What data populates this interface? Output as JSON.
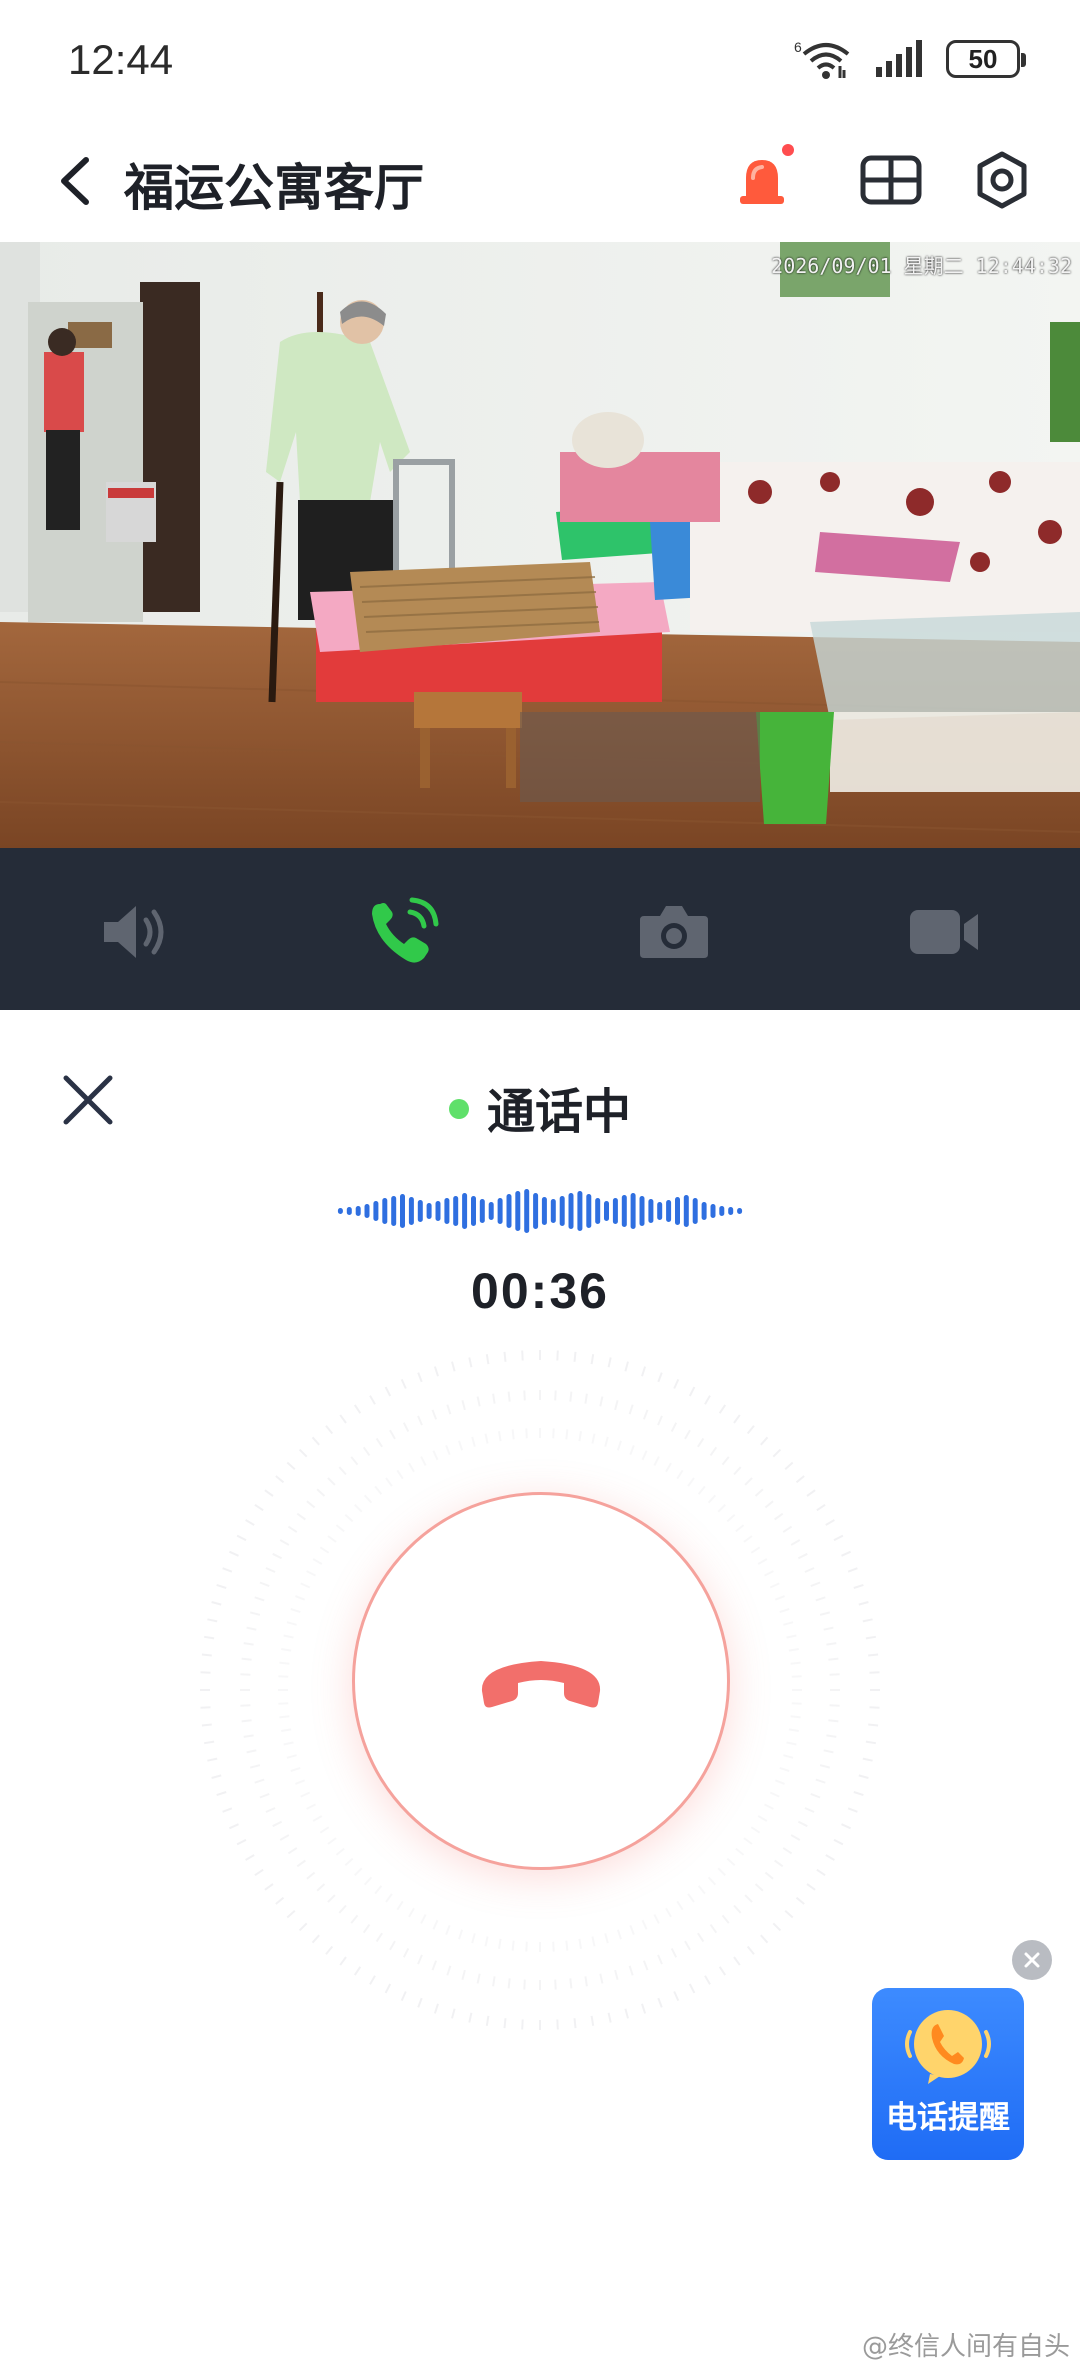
{
  "status_bar": {
    "time": "12:44",
    "network": "6",
    "battery": "50"
  },
  "header": {
    "title": "福运公寓客厅",
    "icons": [
      "back-arrow-icon",
      "alarm-bell-icon",
      "grid-layout-icon",
      "settings-icon"
    ]
  },
  "video": {
    "timestamp": "2026/09/01 星期二 12:44:32"
  },
  "controls": [
    {
      "name": "speaker",
      "icon": "speaker-icon",
      "active": false
    },
    {
      "name": "call",
      "icon": "phone-call-icon",
      "active": true
    },
    {
      "name": "snapshot",
      "icon": "camera-icon",
      "active": false
    },
    {
      "name": "record",
      "icon": "video-record-icon",
      "active": false
    }
  ],
  "call": {
    "status": "通话中",
    "duration": "00:36"
  },
  "ad": {
    "label": "电话提醒"
  },
  "watermark": "@终信人间有自头",
  "colors": {
    "control_bar": "#252c38",
    "call_active": "#31c94a",
    "hangup": "#f26f6b",
    "alarm": "#ff5a3c",
    "wave": "#2f6fe0",
    "ad_blue": "#2b7bff"
  }
}
